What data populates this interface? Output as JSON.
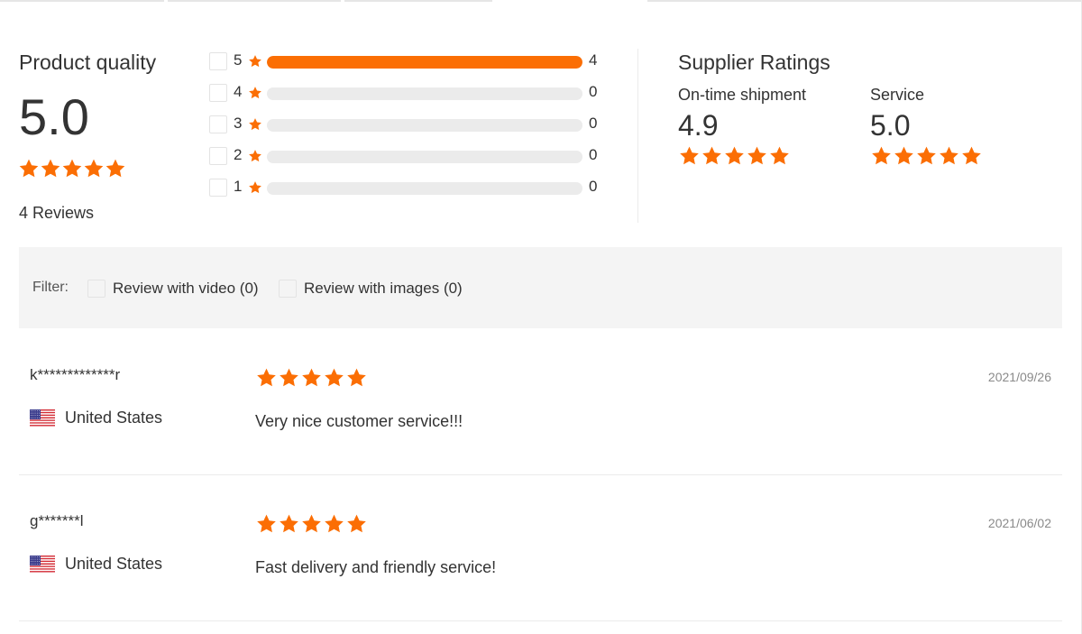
{
  "colors": {
    "accent": "#fb6e04",
    "star": "#fb6e04",
    "bar_bg": "#ebebeb",
    "filter_bg": "#f4f4f4"
  },
  "product_quality": {
    "title": "Product quality",
    "score": "5.0",
    "stars": 5,
    "reviews_label": "4 Reviews"
  },
  "histogram": [
    {
      "stars": "5",
      "count": "4",
      "fraction": 1.0
    },
    {
      "stars": "4",
      "count": "0",
      "fraction": 0
    },
    {
      "stars": "3",
      "count": "0",
      "fraction": 0
    },
    {
      "stars": "2",
      "count": "0",
      "fraction": 0
    },
    {
      "stars": "1",
      "count": "0",
      "fraction": 0
    }
  ],
  "supplier": {
    "title": "Supplier Ratings",
    "ontime": {
      "label": "On-time shipment",
      "value": "4.9",
      "stars": 5
    },
    "service": {
      "label": "Service",
      "value": "5.0",
      "stars": 5
    }
  },
  "filter": {
    "label": "Filter:",
    "options": [
      {
        "label": "Review with video (0)"
      },
      {
        "label": "Review with images (0)"
      }
    ]
  },
  "reviews": [
    {
      "user": "k*************r",
      "country": "United States",
      "flag": "us-flag-icon",
      "stars": 5,
      "text": "Very nice customer service!!!",
      "date": "2021/09/26"
    },
    {
      "user": "g*******l",
      "country": "United States",
      "flag": "us-flag-icon",
      "stars": 5,
      "text": "Fast delivery and friendly service!",
      "date": "2021/06/02"
    }
  ]
}
